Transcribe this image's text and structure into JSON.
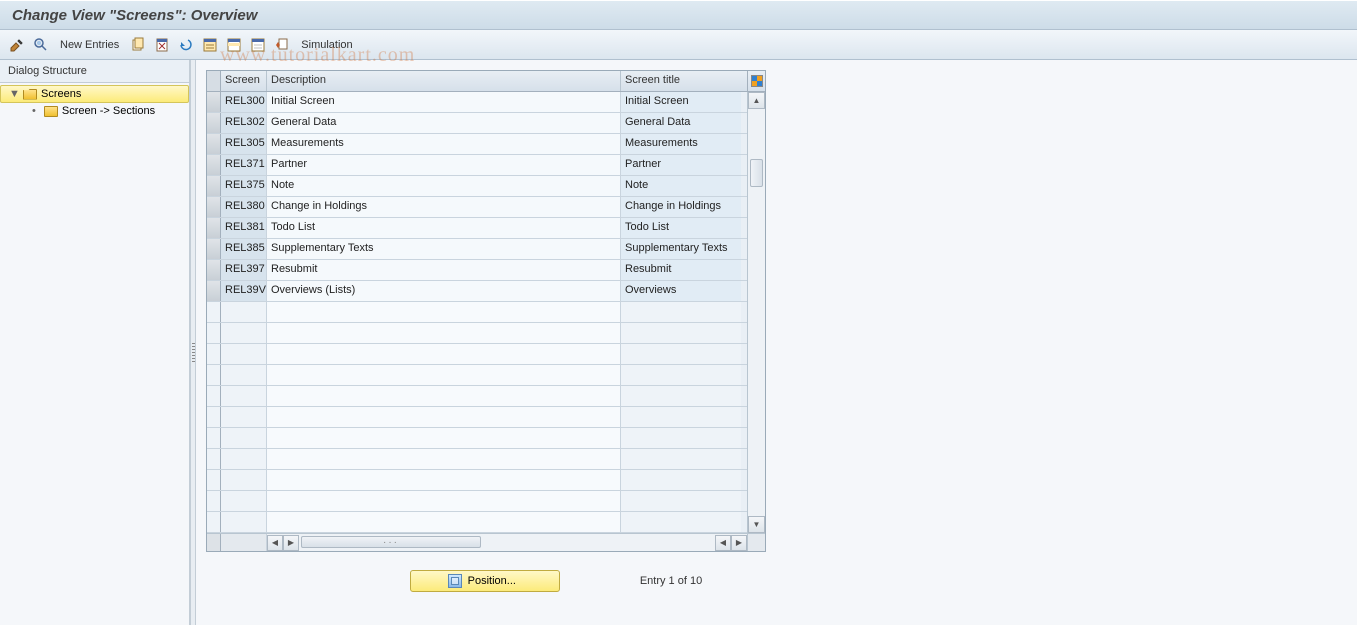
{
  "title": "Change View \"Screens\": Overview",
  "toolbar": {
    "new_entries": "New Entries",
    "simulation": "Simulation"
  },
  "sidebar": {
    "header": "Dialog Structure",
    "items": [
      {
        "label": "Screens",
        "selected": true,
        "level": 1,
        "expandable": true,
        "open": true
      },
      {
        "label": "Screen -> Sections",
        "selected": false,
        "level": 2,
        "expandable": false,
        "open": false
      }
    ]
  },
  "table": {
    "columns": {
      "screen": "Screen",
      "description": "Description",
      "screen_title": "Screen title"
    },
    "rows": [
      {
        "screen": "REL300",
        "description": "Initial Screen",
        "title": "Initial Screen"
      },
      {
        "screen": "REL302",
        "description": "General Data",
        "title": "General Data"
      },
      {
        "screen": "REL305",
        "description": "Measurements",
        "title": "Measurements"
      },
      {
        "screen": "REL371",
        "description": "Partner",
        "title": "Partner"
      },
      {
        "screen": "REL375",
        "description": "Note",
        "title": "Note"
      },
      {
        "screen": "REL380",
        "description": "Change in Holdings",
        "title": "Change in Holdings"
      },
      {
        "screen": "REL381",
        "description": "Todo List",
        "title": "Todo List"
      },
      {
        "screen": "REL385",
        "description": "Supplementary Texts",
        "title": "Supplementary Texts"
      },
      {
        "screen": "REL397",
        "description": "Resubmit",
        "title": "Resubmit"
      },
      {
        "screen": "REL39V",
        "description": "Overviews (Lists)",
        "title": "Overviews"
      }
    ],
    "empty_rows": 11
  },
  "footer": {
    "position_button": "Position...",
    "entry_text": "Entry 1 of 10"
  },
  "watermark": "www.tutorialkart.com"
}
